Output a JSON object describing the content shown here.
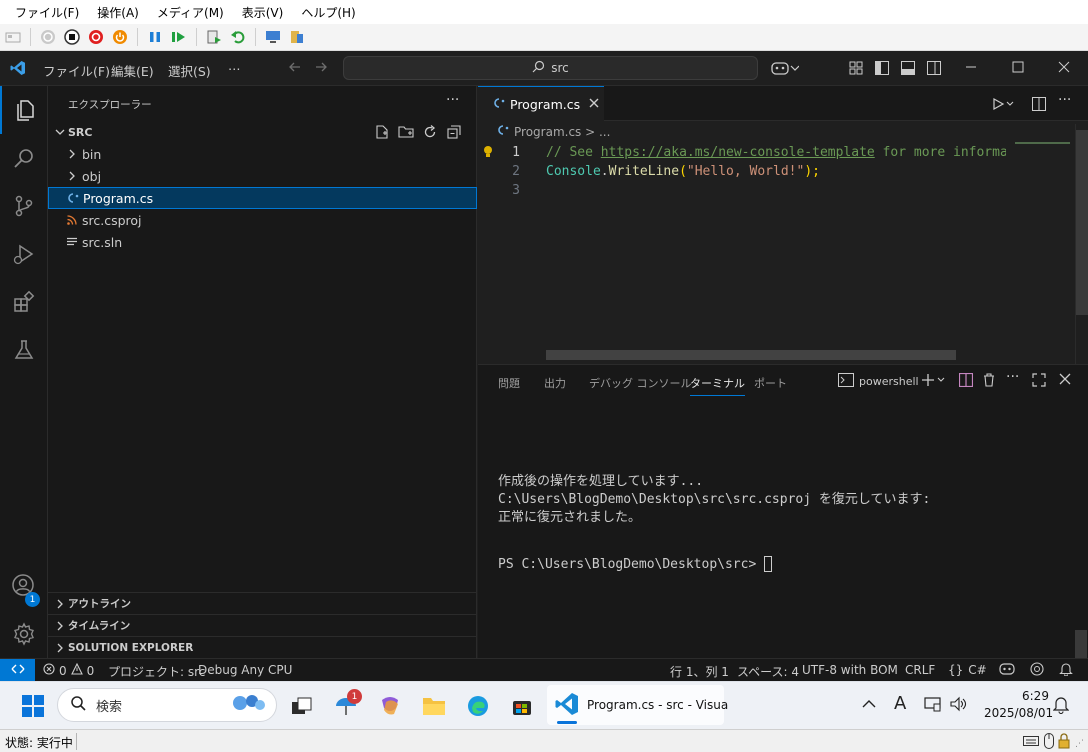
{
  "host_menu": [
    "ファイル(F)",
    "操作(A)",
    "メディア(M)",
    "表示(V)",
    "ヘルプ(H)"
  ],
  "vscode": {
    "menus": [
      "ファイル(F)",
      "編集(E)",
      "選択(S)",
      "…"
    ],
    "search": "src",
    "sidebar_title": "エクスプローラー",
    "folder_name": "SRC",
    "tree": [
      {
        "label": "bin",
        "kind": "folder"
      },
      {
        "label": "obj",
        "kind": "folder"
      },
      {
        "label": "Program.cs",
        "kind": "cs",
        "selected": true
      },
      {
        "label": "src.csproj",
        "kind": "rss"
      },
      {
        "label": "src.sln",
        "kind": "lines"
      }
    ],
    "sections": [
      "アウトライン",
      "タイムライン",
      "SOLUTION EXPLORER"
    ],
    "tab_label": "Program.cs",
    "breadcrumb": "Program.cs > ...",
    "code": {
      "line_numbers": [
        "1",
        "2",
        "3"
      ],
      "l1_comment": "// See ",
      "l1_link": "https://aka.ms/new-console-template",
      "l1_rest": " for more informat",
      "l2_class": "Console",
      "l2_dot": ".",
      "l2_method": "WriteLine",
      "l2_open": "(",
      "l2_string": "\"Hello, World!\"",
      "l2_close": ");"
    },
    "panel_tabs": [
      "問題",
      "出力",
      "デバッグ コンソール",
      "ターミナル",
      "ポート"
    ],
    "terminal_name": "powershell",
    "terminal_lines": [
      "作成後の操作を処理しています...",
      "C:\\Users\\BlogDemo\\Desktop\\src\\src.csproj を復元しています:",
      "正常に復元されました。",
      "PS C:\\Users\\BlogDemo\\Desktop\\src> "
    ],
    "status": {
      "problems": "0",
      "warnings": "0",
      "project": "プロジェクト: src",
      "debug": "Debug Any CPU",
      "position": "行 1、列 1",
      "spaces": "スペース: 4",
      "encoding": "UTF-8 with BOM",
      "eol": "CRLF",
      "language": "C#",
      "accounts_badge": "1"
    }
  },
  "taskbar": {
    "search_placeholder": "検索",
    "active_app": "Program.cs - src - Visua",
    "weather_badge": "1",
    "ime": "A",
    "time": "6:29",
    "date": "2025/08/01"
  },
  "host_status": "状態: 実行中",
  "colors": {
    "accent": "#0078d4",
    "selection": "#04395e",
    "comment": "#6a9955",
    "class": "#4ec9b0",
    "method": "#dcdcaa",
    "string": "#ce9178"
  }
}
